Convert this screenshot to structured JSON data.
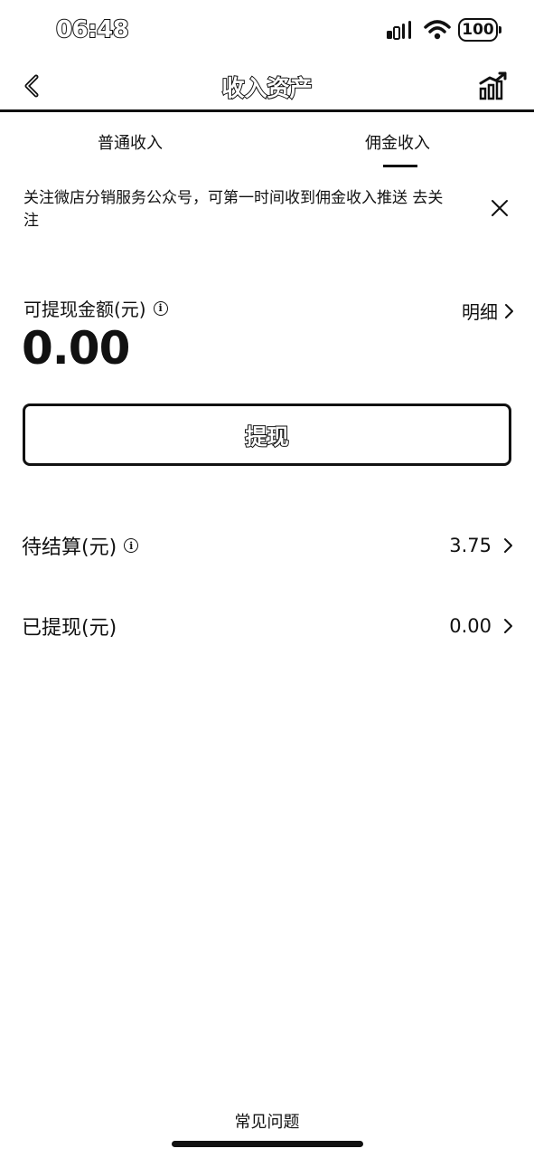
{
  "status_bar": {
    "time": "06:48",
    "battery": "100",
    "icons": [
      "signal-icon",
      "wifi-icon",
      "battery-icon"
    ]
  },
  "nav": {
    "title": "收入资产",
    "back_icon": "chevron-left-icon",
    "chart_icon": "bar-chart-trend-icon"
  },
  "tabs": [
    {
      "label": "普通收入",
      "active": false
    },
    {
      "label": "佣金收入",
      "active": true
    }
  ],
  "notice": {
    "text": "关注微店分销服务公众号，可第一时间收到佣金收入推送",
    "action": "去关注",
    "close_icon": "close-icon"
  },
  "withdrawable": {
    "label": "可提现金额(元)",
    "detail_link": "明细",
    "amount": "0.00"
  },
  "withdraw_button": "提现",
  "rows": {
    "pending": {
      "label": "待结算(元)",
      "value": "3.75"
    },
    "withdrawn": {
      "label": "已提现(元)",
      "value": "0.00"
    }
  },
  "footer": {
    "faq": "常见问题"
  },
  "colors": {
    "text": "#111111",
    "background": "#ffffff"
  }
}
